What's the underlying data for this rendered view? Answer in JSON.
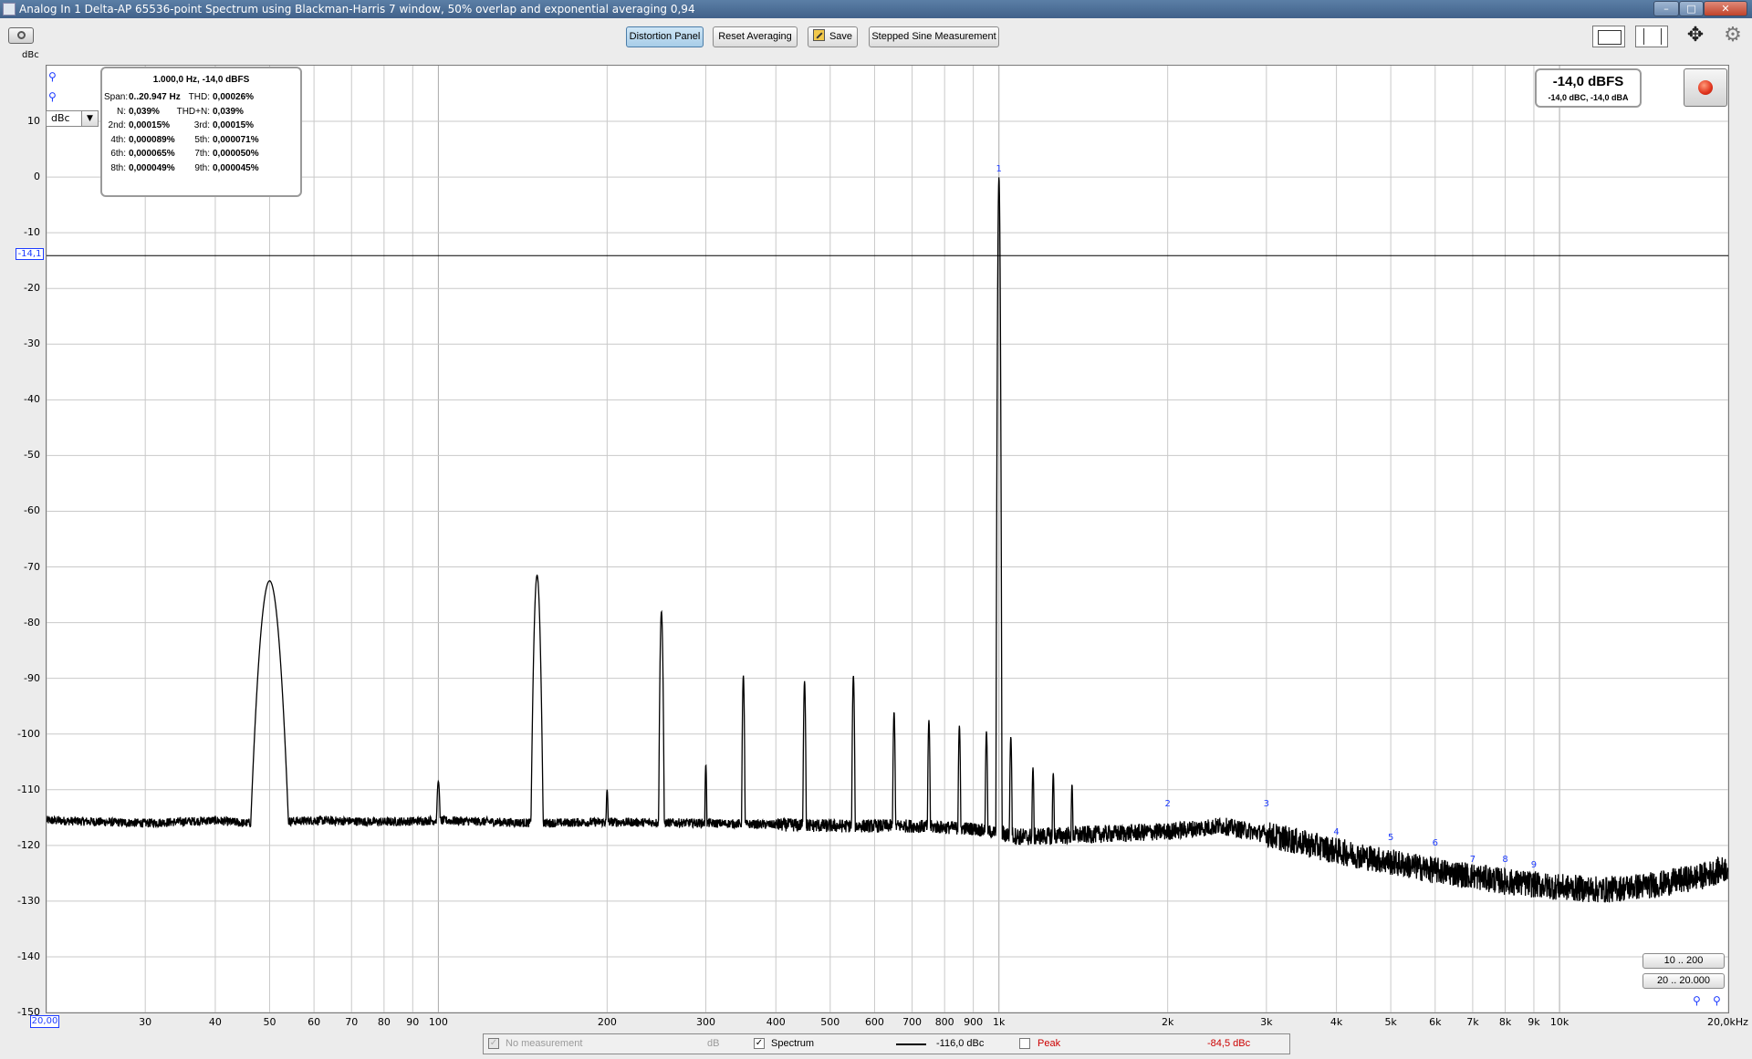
{
  "window": {
    "title": "Analog In 1 Delta-AP 65536-point Spectrum using Blackman-Harris 7 window, 50% overlap and exponential averaging 0,94",
    "minimize": "–",
    "maximize": "□",
    "close": "✕"
  },
  "toolbar": {
    "distortion_panel": "Distortion Panel",
    "reset_averaging": "Reset Averaging",
    "save": "Save",
    "stepped_sine": "Stepped Sine Measurement",
    "icons": [
      "camera-icon",
      "layout-single-icon",
      "layout-split-icon",
      "move-arrows-icon",
      "gear-icon"
    ]
  },
  "y_axis": {
    "unit_label": "dBc",
    "unit_select": "dBc",
    "cursor_value": "-14,1"
  },
  "x_axis": {
    "start_value": "20,00",
    "end_label": "20,0kHz"
  },
  "distortion_panel": {
    "header": "1.000,0 Hz, -14,0 dBFS",
    "rows": [
      {
        "l1": "Span:",
        "v1": "0..20.947 Hz",
        "l2": "THD:",
        "v2": "0,00026%"
      },
      {
        "l1": "N:",
        "v1": "0,039%",
        "l2": "THD+N:",
        "v2": "0,039%"
      },
      {
        "l1": "2nd:",
        "v1": "0,00015%",
        "l2": "3rd:",
        "v2": "0,00015%"
      },
      {
        "l1": "4th:",
        "v1": "0,000089%",
        "l2": "5th:",
        "v2": "0,000071%"
      },
      {
        "l1": "6th:",
        "v1": "0,000065%",
        "l2": "7th:",
        "v2": "0,000050%"
      },
      {
        "l1": "8th:",
        "v1": "0,000049%",
        "l2": "9th:",
        "v2": "0,000045%"
      }
    ]
  },
  "level": {
    "main": "-14,0 dBFS",
    "sub": "-14,0 dBC, -14,0 dBA"
  },
  "range_buttons": [
    "10 .. 200",
    "20 .. 20.000"
  ],
  "legend": {
    "no_measurement": "No measurement",
    "no_measurement_unit": "dB",
    "spectrum": "Spectrum",
    "spectrum_value": "-116,0 dBc",
    "peak": "Peak",
    "peak_value": "-84,5 dBc",
    "spectrum_checked": true,
    "peak_checked": false
  },
  "colors": {
    "trace": "#000000",
    "harmonic_labels": "#1e3cff",
    "peak_value": "#cc0000",
    "grid": "#c9c9c9"
  },
  "chart_data": {
    "type": "line",
    "x_scale": "log",
    "xlim": [
      20,
      20000
    ],
    "ylim": [
      -150,
      20
    ],
    "y_unit": "dBc",
    "grid": true,
    "y_ticks": [
      10,
      0,
      -10,
      -20,
      -30,
      -40,
      -50,
      -60,
      -70,
      -80,
      -90,
      -100,
      -110,
      -120,
      -130,
      -140,
      -150
    ],
    "x_ticks": [
      {
        "v": 30,
        "label": "30"
      },
      {
        "v": 40,
        "label": "40"
      },
      {
        "v": 50,
        "label": "50"
      },
      {
        "v": 60,
        "label": "60"
      },
      {
        "v": 70,
        "label": "70"
      },
      {
        "v": 80,
        "label": "80"
      },
      {
        "v": 90,
        "label": "90"
      },
      {
        "v": 100,
        "label": "100"
      },
      {
        "v": 200,
        "label": "200"
      },
      {
        "v": 300,
        "label": "300"
      },
      {
        "v": 400,
        "label": "400"
      },
      {
        "v": 500,
        "label": "500"
      },
      {
        "v": 600,
        "label": "600"
      },
      {
        "v": 700,
        "label": "700"
      },
      {
        "v": 800,
        "label": "800"
      },
      {
        "v": 900,
        "label": "900"
      },
      {
        "v": 1000,
        "label": "1k"
      },
      {
        "v": 2000,
        "label": "2k"
      },
      {
        "v": 3000,
        "label": "3k"
      },
      {
        "v": 4000,
        "label": "4k"
      },
      {
        "v": 5000,
        "label": "5k"
      },
      {
        "v": 6000,
        "label": "6k"
      },
      {
        "v": 7000,
        "label": "7k"
      },
      {
        "v": 8000,
        "label": "8k"
      },
      {
        "v": 9000,
        "label": "9k"
      },
      {
        "v": 10000,
        "label": "10k"
      }
    ],
    "cursor_y": -14.1,
    "noise_floor": [
      [
        20,
        -115.5
      ],
      [
        30,
        -116
      ],
      [
        40,
        -115.5
      ],
      [
        45,
        -116
      ],
      [
        60,
        -115.5
      ],
      [
        80,
        -115.8
      ],
      [
        100,
        -115.5
      ],
      [
        150,
        -116
      ],
      [
        200,
        -115.8
      ],
      [
        300,
        -116
      ],
      [
        500,
        -116.5
      ],
      [
        700,
        -116.5
      ],
      [
        900,
        -117
      ],
      [
        1100,
        -118.5
      ],
      [
        1500,
        -118
      ],
      [
        2000,
        -117.5
      ],
      [
        2500,
        -116.5
      ],
      [
        3000,
        -118
      ],
      [
        4000,
        -121
      ],
      [
        5000,
        -123
      ],
      [
        6000,
        -124.5
      ],
      [
        7000,
        -125.5
      ],
      [
        8000,
        -126.5
      ],
      [
        10000,
        -127.5
      ],
      [
        12000,
        -128
      ],
      [
        15000,
        -127
      ],
      [
        18000,
        -125.5
      ],
      [
        20000,
        -124
      ]
    ],
    "peaks": [
      {
        "f": 50,
        "db": -72.5,
        "width": 0.025
      },
      {
        "f": 100,
        "db": -108.5,
        "width": 0.006
      },
      {
        "f": 150,
        "db": -71.5,
        "width": 0.008
      },
      {
        "f": 200,
        "db": -110,
        "width": 0.004
      },
      {
        "f": 250,
        "db": -78,
        "width": 0.004
      },
      {
        "f": 300,
        "db": -105.5,
        "width": 0.003
      },
      {
        "f": 350,
        "db": -89.5,
        "width": 0.003
      },
      {
        "f": 450,
        "db": -90.5,
        "width": 0.003
      },
      {
        "f": 550,
        "db": -89.5,
        "width": 0.003
      },
      {
        "f": 650,
        "db": -96,
        "width": 0.003
      },
      {
        "f": 750,
        "db": -97.5,
        "width": 0.003
      },
      {
        "f": 850,
        "db": -98.5,
        "width": 0.003
      },
      {
        "f": 950,
        "db": -99.5,
        "width": 0.003
      },
      {
        "f": 1000,
        "db": 0,
        "width": 0.0025
      },
      {
        "f": 1050,
        "db": -100.5,
        "width": 0.003
      },
      {
        "f": 1150,
        "db": -106,
        "width": 0.003
      },
      {
        "f": 1250,
        "db": -107,
        "width": 0.003
      },
      {
        "f": 1350,
        "db": -109,
        "width": 0.003
      }
    ],
    "harmonics": [
      {
        "n": "1",
        "f": 1000,
        "db": 0
      },
      {
        "n": "2",
        "f": 2000,
        "db": -114
      },
      {
        "n": "3",
        "f": 3000,
        "db": -114
      },
      {
        "n": "4",
        "f": 4000,
        "db": -119
      },
      {
        "n": "5",
        "f": 5000,
        "db": -120
      },
      {
        "n": "6",
        "f": 6000,
        "db": -121
      },
      {
        "n": "7",
        "f": 7000,
        "db": -124
      },
      {
        "n": "8",
        "f": 8000,
        "db": -124
      },
      {
        "n": "9",
        "f": 9000,
        "db": -125
      }
    ]
  }
}
